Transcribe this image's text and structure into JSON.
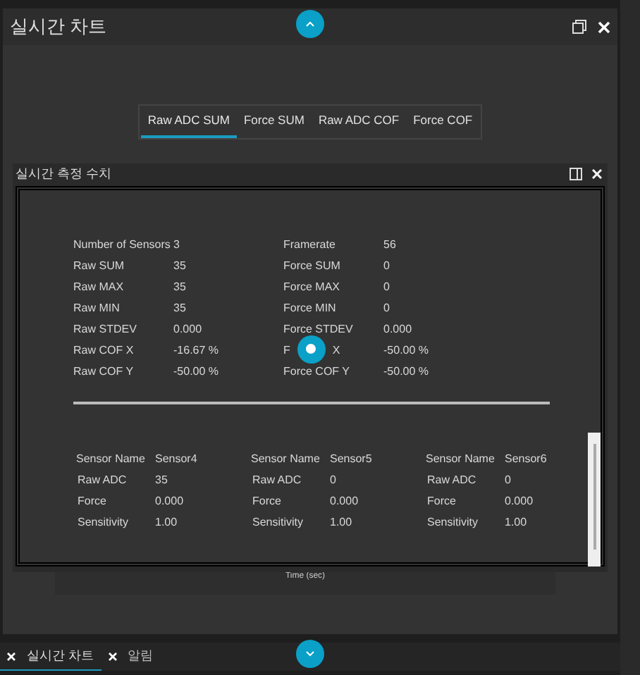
{
  "window": {
    "title": "실시간 차트"
  },
  "chart_tabs": [
    {
      "label": "Raw ADC SUM",
      "selected": true
    },
    {
      "label": "Force SUM",
      "selected": false
    },
    {
      "label": "Raw ADC COF",
      "selected": false
    },
    {
      "label": "Force COF",
      "selected": false
    }
  ],
  "panel": {
    "title": "실시간 측정 수치",
    "left_stats": [
      {
        "label": "Number of Sensors",
        "value": "3"
      },
      {
        "label": "Raw SUM",
        "value": "35"
      },
      {
        "label": "Raw MAX",
        "value": "35"
      },
      {
        "label": "Raw MIN",
        "value": "35"
      },
      {
        "label": "Raw STDEV",
        "value": "0.000"
      },
      {
        "label": "Raw COF X",
        "value": "-16.67 %"
      },
      {
        "label": "Raw COF Y",
        "value": "-50.00 %"
      }
    ],
    "right_stats": [
      {
        "label": "Framerate",
        "value": "56"
      },
      {
        "label": "Force SUM",
        "value": "0"
      },
      {
        "label": "Force MAX",
        "value": "0"
      },
      {
        "label": "Force MIN",
        "value": "0"
      },
      {
        "label": "Force STDEV",
        "value": "0.000"
      },
      {
        "label_parts": [
          "F",
          "X"
        ],
        "value": "-50.00 %"
      },
      {
        "label": "Force COF Y",
        "value": "-50.00 %"
      }
    ],
    "sensors": [
      {
        "rows": [
          {
            "label": "Sensor Name",
            "value": "Sensor4"
          },
          {
            "label": "Raw ADC",
            "value": "35"
          },
          {
            "label": "Force",
            "value": "0.000"
          },
          {
            "label": "Sensitivity",
            "value": "1.00"
          }
        ]
      },
      {
        "rows": [
          {
            "label": "Sensor Name",
            "value": "Sensor5"
          },
          {
            "label": "Raw ADC",
            "value": "0"
          },
          {
            "label": "Force",
            "value": "0.000"
          },
          {
            "label": "Sensitivity",
            "value": "1.00"
          }
        ]
      },
      {
        "rows": [
          {
            "label": "Sensor Name",
            "value": "Sensor6"
          },
          {
            "label": "Raw ADC",
            "value": "0"
          },
          {
            "label": "Force",
            "value": "0.000"
          },
          {
            "label": "Sensitivity",
            "value": "1.00"
          }
        ]
      }
    ]
  },
  "axis_label": "Time (sec)",
  "bottom_tabs": [
    {
      "label": "실시간 차트",
      "selected": true
    },
    {
      "label": "알림",
      "selected": false
    }
  ]
}
